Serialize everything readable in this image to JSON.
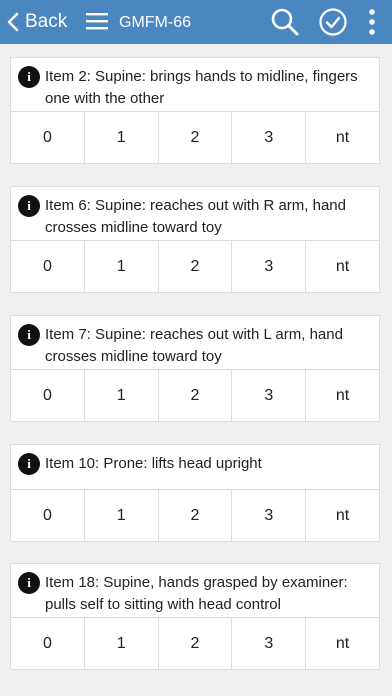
{
  "nav": {
    "back_label": "Back",
    "title": "GMFM-66",
    "icons": [
      "chevron-left-icon",
      "menu-icon",
      "search-icon",
      "check-circle-icon",
      "more-vertical-icon"
    ]
  },
  "info_glyph": "i",
  "scores": [
    "0",
    "1",
    "2",
    "3",
    "nt"
  ],
  "items": [
    {
      "text": "Item 2: Supine: brings hands to midline, fingers one with the other"
    },
    {
      "text": "Item 6: Supine: reaches out with R arm, hand crosses midline toward toy"
    },
    {
      "text": "Item 7: Supine: reaches out with L arm, hand crosses midline toward toy"
    },
    {
      "text": "Item 10: Prone: lifts head upright"
    },
    {
      "text": "Item 18: Supine, hands grasped by examiner: pulls self to sitting with head control"
    }
  ],
  "colors": {
    "navbar": "#4a86c0",
    "background": "#f0f0f0"
  }
}
